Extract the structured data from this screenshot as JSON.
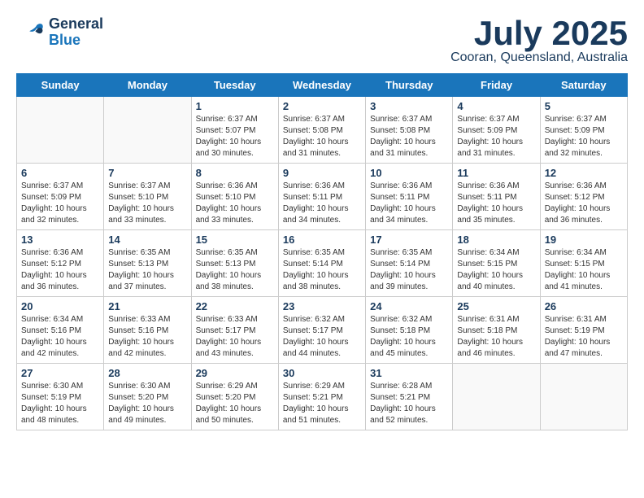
{
  "header": {
    "logo": {
      "general": "General",
      "blue": "Blue"
    },
    "title": "July 2025",
    "location": "Cooran, Queensland, Australia"
  },
  "calendar": {
    "days_of_week": [
      "Sunday",
      "Monday",
      "Tuesday",
      "Wednesday",
      "Thursday",
      "Friday",
      "Saturday"
    ],
    "weeks": [
      [
        {
          "day": "",
          "info": ""
        },
        {
          "day": "",
          "info": ""
        },
        {
          "day": "1",
          "info": "Sunrise: 6:37 AM\nSunset: 5:07 PM\nDaylight: 10 hours and 30 minutes."
        },
        {
          "day": "2",
          "info": "Sunrise: 6:37 AM\nSunset: 5:08 PM\nDaylight: 10 hours and 31 minutes."
        },
        {
          "day": "3",
          "info": "Sunrise: 6:37 AM\nSunset: 5:08 PM\nDaylight: 10 hours and 31 minutes."
        },
        {
          "day": "4",
          "info": "Sunrise: 6:37 AM\nSunset: 5:09 PM\nDaylight: 10 hours and 31 minutes."
        },
        {
          "day": "5",
          "info": "Sunrise: 6:37 AM\nSunset: 5:09 PM\nDaylight: 10 hours and 32 minutes."
        }
      ],
      [
        {
          "day": "6",
          "info": "Sunrise: 6:37 AM\nSunset: 5:09 PM\nDaylight: 10 hours and 32 minutes."
        },
        {
          "day": "7",
          "info": "Sunrise: 6:37 AM\nSunset: 5:10 PM\nDaylight: 10 hours and 33 minutes."
        },
        {
          "day": "8",
          "info": "Sunrise: 6:36 AM\nSunset: 5:10 PM\nDaylight: 10 hours and 33 minutes."
        },
        {
          "day": "9",
          "info": "Sunrise: 6:36 AM\nSunset: 5:11 PM\nDaylight: 10 hours and 34 minutes."
        },
        {
          "day": "10",
          "info": "Sunrise: 6:36 AM\nSunset: 5:11 PM\nDaylight: 10 hours and 34 minutes."
        },
        {
          "day": "11",
          "info": "Sunrise: 6:36 AM\nSunset: 5:11 PM\nDaylight: 10 hours and 35 minutes."
        },
        {
          "day": "12",
          "info": "Sunrise: 6:36 AM\nSunset: 5:12 PM\nDaylight: 10 hours and 36 minutes."
        }
      ],
      [
        {
          "day": "13",
          "info": "Sunrise: 6:36 AM\nSunset: 5:12 PM\nDaylight: 10 hours and 36 minutes."
        },
        {
          "day": "14",
          "info": "Sunrise: 6:35 AM\nSunset: 5:13 PM\nDaylight: 10 hours and 37 minutes."
        },
        {
          "day": "15",
          "info": "Sunrise: 6:35 AM\nSunset: 5:13 PM\nDaylight: 10 hours and 38 minutes."
        },
        {
          "day": "16",
          "info": "Sunrise: 6:35 AM\nSunset: 5:14 PM\nDaylight: 10 hours and 38 minutes."
        },
        {
          "day": "17",
          "info": "Sunrise: 6:35 AM\nSunset: 5:14 PM\nDaylight: 10 hours and 39 minutes."
        },
        {
          "day": "18",
          "info": "Sunrise: 6:34 AM\nSunset: 5:15 PM\nDaylight: 10 hours and 40 minutes."
        },
        {
          "day": "19",
          "info": "Sunrise: 6:34 AM\nSunset: 5:15 PM\nDaylight: 10 hours and 41 minutes."
        }
      ],
      [
        {
          "day": "20",
          "info": "Sunrise: 6:34 AM\nSunset: 5:16 PM\nDaylight: 10 hours and 42 minutes."
        },
        {
          "day": "21",
          "info": "Sunrise: 6:33 AM\nSunset: 5:16 PM\nDaylight: 10 hours and 42 minutes."
        },
        {
          "day": "22",
          "info": "Sunrise: 6:33 AM\nSunset: 5:17 PM\nDaylight: 10 hours and 43 minutes."
        },
        {
          "day": "23",
          "info": "Sunrise: 6:32 AM\nSunset: 5:17 PM\nDaylight: 10 hours and 44 minutes."
        },
        {
          "day": "24",
          "info": "Sunrise: 6:32 AM\nSunset: 5:18 PM\nDaylight: 10 hours and 45 minutes."
        },
        {
          "day": "25",
          "info": "Sunrise: 6:31 AM\nSunset: 5:18 PM\nDaylight: 10 hours and 46 minutes."
        },
        {
          "day": "26",
          "info": "Sunrise: 6:31 AM\nSunset: 5:19 PM\nDaylight: 10 hours and 47 minutes."
        }
      ],
      [
        {
          "day": "27",
          "info": "Sunrise: 6:30 AM\nSunset: 5:19 PM\nDaylight: 10 hours and 48 minutes."
        },
        {
          "day": "28",
          "info": "Sunrise: 6:30 AM\nSunset: 5:20 PM\nDaylight: 10 hours and 49 minutes."
        },
        {
          "day": "29",
          "info": "Sunrise: 6:29 AM\nSunset: 5:20 PM\nDaylight: 10 hours and 50 minutes."
        },
        {
          "day": "30",
          "info": "Sunrise: 6:29 AM\nSunset: 5:21 PM\nDaylight: 10 hours and 51 minutes."
        },
        {
          "day": "31",
          "info": "Sunrise: 6:28 AM\nSunset: 5:21 PM\nDaylight: 10 hours and 52 minutes."
        },
        {
          "day": "",
          "info": ""
        },
        {
          "day": "",
          "info": ""
        }
      ]
    ]
  }
}
